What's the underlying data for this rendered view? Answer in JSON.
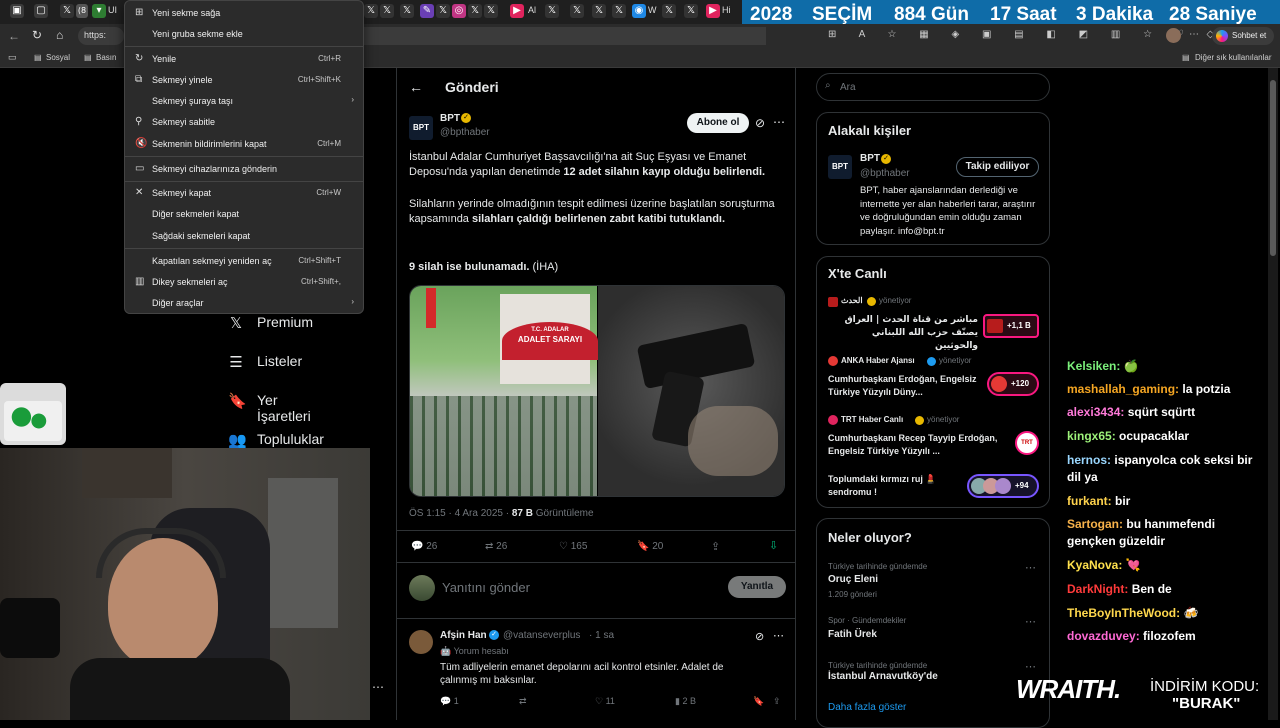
{
  "browser": {
    "tabs_visible_letters": [
      "UI",
      "X",
      "X",
      "X",
      "Al",
      "X",
      "X",
      "X",
      "W",
      "X",
      "Hi"
    ],
    "url_prefix": "https:",
    "bookmarks": [
      "Sosyal",
      "Basın"
    ],
    "other_bookmarks": "Diğer sık kullanılanlar",
    "chat_button": "Sohbet et"
  },
  "countdown": {
    "year": "2028",
    "label": "SEÇİM",
    "days": "884 Gün",
    "hours": "17 Saat",
    "minutes": "3 Dakika",
    "seconds": "28 Saniye"
  },
  "context_menu": {
    "items": [
      {
        "label": "Yeni sekme sağa",
        "shortcut": "",
        "icon": "new-tab-icon"
      },
      {
        "label": "Yeni gruba sekme ekle",
        "shortcut": ""
      },
      {
        "label": "Yenile",
        "shortcut": "Ctrl+R",
        "icon": "reload-icon"
      },
      {
        "label": "Sekmeyi yinele",
        "shortcut": "Ctrl+Shift+K",
        "icon": "duplicate-icon"
      },
      {
        "label": "Sekmeyi şuraya taşı",
        "shortcut": "",
        "submenu": true
      },
      {
        "label": "Sekmeyi sabitle",
        "shortcut": "",
        "icon": "pin-icon"
      },
      {
        "label": "Sekmenin bildirimlerini kapat",
        "shortcut": "Ctrl+M",
        "icon": "mute-icon"
      },
      {
        "label": "Sekmeyi cihazlarınıza gönderin",
        "shortcut": "",
        "icon": "devices-icon"
      },
      {
        "label": "Sekmeyi kapat",
        "shortcut": "Ctrl+W",
        "icon": "close-icon"
      },
      {
        "label": "Diğer sekmeleri kapat",
        "shortcut": ""
      },
      {
        "label": "Sağdaki sekmeleri kapat",
        "shortcut": ""
      },
      {
        "label": "Kapatılan sekmeyi yeniden aç",
        "shortcut": "Ctrl+Shift+T"
      },
      {
        "label": "Dikey sekmeleri aç",
        "shortcut": "Ctrl+Shift+,",
        "icon": "vertical-tabs-icon"
      },
      {
        "label": "Diğer araçlar",
        "shortcut": "",
        "submenu": true
      }
    ]
  },
  "left_nav": [
    {
      "label": "Premium",
      "icon": "x-logo-icon"
    },
    {
      "label": "Listeler",
      "icon": "list-icon"
    },
    {
      "label": "Yer İşaretleri",
      "icon": "bookmark-icon"
    },
    {
      "label": "Topluluklar",
      "icon": "communities-icon"
    }
  ],
  "post": {
    "header": "Gönderi",
    "author": "BPT",
    "handle": "@bpthaber",
    "subscribe": "Abone ol",
    "p1_a": "İstanbul Adalar Cumhuriyet Başsavcılığı'na ait Suç Eşyası ve Emanet Deposu'nda yapılan denetimde ",
    "p1_b": "12 adet silahın kayıp olduğu belirlendi.",
    "p2_a": "Silahların yerinde olmadığının tespit edilmesi üzerine başlatılan soruşturma kapsamında ",
    "p2_b": "silahları çaldığı belirlenen zabıt katibi tutuklandı.",
    "p3_a": "9 silah ise bulunamadı.",
    "p3_b": " (İHA)",
    "image_sign_top": "T.C. ADALAR",
    "image_sign": "ADALET SARAYI",
    "time": "ÖS 1:15 · 4 Ara 2025 · ",
    "views": "87 B",
    "views_label": " Görüntüleme",
    "replies": "26",
    "reposts": "26",
    "likes": "165",
    "bookmarks": "20",
    "reply_placeholder": "Yanıtını gönder",
    "reply_button": "Yanıtla"
  },
  "reply": {
    "author": "Afşin Han",
    "handle": "@vatanseverplus",
    "age": "· 1 sa",
    "badge": "Yorum hesabı",
    "text": "Tüm adliyelerin emanet depolarını acil kontrol etsinler. Adalet de çalınmış mı baksınlar.",
    "replies": "1",
    "likes": "11",
    "views": "2 B"
  },
  "search": {
    "placeholder": "Ara"
  },
  "related": {
    "title": "Alakalı kişiler",
    "name": "BPT",
    "handle": "@bpthaber",
    "follow": "Takip ediliyor",
    "bio": "BPT, haber ajanslarından derlediği ve internette yer alan haberleri tarar, araştırır ve doğruluğundan emin olduğu zaman paylaşır. info@bpt.tr"
  },
  "live": {
    "title": "X'te Canlı",
    "items": [
      {
        "source": "الحدث",
        "role": "yönetiyor",
        "text": "مباشر من قناة الحدث | العراق يصنّف حزب الله اللبناني والحوثيين",
        "count": "+1,1 B"
      },
      {
        "source": "ANKA Haber Ajansı",
        "role": "yönetiyor",
        "text": "Cumhurbaşkanı Erdoğan, Engelsiz Türkiye Yüzyılı Düny...",
        "count": "+120"
      },
      {
        "source": "TRT Haber Canlı",
        "role": "yönetiyor",
        "text": "Cumhurbaşkanı Recep Tayyip Erdoğan, Engelsiz Türkiye Yüzyılı ...",
        "count": ""
      },
      {
        "source": "",
        "role": "",
        "text": "Toplumdaki kırmızı ruj 💄 sendromu !",
        "count": "+94"
      }
    ]
  },
  "trends": {
    "title": "Neler oluyor?",
    "items": [
      {
        "context": "Türkiye tarihinde gündemde",
        "name": "Oruç Eleni",
        "count": "1.209 gönderi"
      },
      {
        "context": "Spor · Gündemdekiler",
        "name": "Fatih Ürek",
        "count": ""
      },
      {
        "context": "Türkiye tarihinde gündemde",
        "name": "İstanbul Arnavutköy'de",
        "count": ""
      }
    ],
    "more": "Daha fazla göster"
  },
  "chat": [
    {
      "user": "Kelsiken:",
      "msg": "🍏",
      "color": "#7bf07b"
    },
    {
      "user": "mashallah_gaming:",
      "msg": "la potzia",
      "color": "#f5a623"
    },
    {
      "user": "alexi3434:",
      "msg": "sqürt sqürtt",
      "color": "#ff7ad9"
    },
    {
      "user": "kingx65:",
      "msg": "ocupacaklar",
      "color": "#9df27a"
    },
    {
      "user": "hernos:",
      "msg": "ispanyolca cok seksi bir dil ya",
      "color": "#9ad7ff"
    },
    {
      "user": "furkant:",
      "msg": "bir",
      "color": "#ffd34d"
    },
    {
      "user": "Sartogan:",
      "msg": "bu hanımefendi gençken güzeldir",
      "color": "#f7b24a"
    },
    {
      "user": "KyaNova:",
      "msg": "💘",
      "color": "#ffe14d"
    },
    {
      "user": "DarkNight:",
      "msg": "Ben de",
      "color": "#ff3b3b"
    },
    {
      "user": "TheBoyInTheWood:",
      "msg": "🍻",
      "color": "#ffd84d"
    },
    {
      "user": "dovazduvey:",
      "msg": "filozofem",
      "color": "#ff6ad5"
    }
  ],
  "sponsor": {
    "brand": "WRAITH.",
    "promo": "İNDİRİM KODU:",
    "code": "\"BURAK\""
  },
  "colors": {
    "accent": "#1d9bf0",
    "background": "#000000",
    "border": "#2f3336",
    "menu_bg": "#2b2b2b",
    "live_red": "#f91880"
  }
}
